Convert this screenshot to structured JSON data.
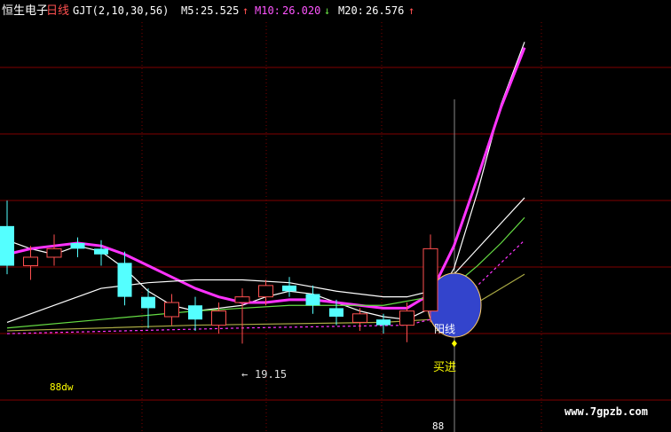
{
  "header": {
    "stock_name": "恒生电子",
    "period": "日线",
    "indicator": "GJT(2,10,30,56)",
    "ma5_label": "M5:",
    "ma5_value": "25.525",
    "ma5_arrow": "↑",
    "ma10_label": "M10:",
    "ma10_value": "26.020",
    "ma10_arrow": "↓",
    "ma20_label": "M20:",
    "ma20_value": "26.576",
    "ma20_arrow": "↑"
  },
  "annotations": {
    "low_price": "19.15",
    "low_arrow": "←",
    "buy_label": "买进",
    "signal_label": "阳线",
    "bottom_left": "88dw",
    "bottom_mid": "88",
    "watermark": "www.7gpzb.com"
  },
  "colors": {
    "background": "#000000",
    "grid": "#800000",
    "up_candle": "#ff5050",
    "down_candle": "#54ffff",
    "ma5": "#ffffff",
    "ma_main": "#ff33ff",
    "ma_green": "#66dd44",
    "ma_olive": "#aaaa44",
    "header_yellow": "#ffff00",
    "header_magenta": "#ff55ff",
    "highlight_circle": "#3344cc",
    "buy_text": "#ffff00"
  },
  "chart_data": {
    "type": "candlestick",
    "title": "恒生电子 日线",
    "price_range": [
      17.5,
      30.5
    ],
    "candles": [
      {
        "dir": "down",
        "open": 23.3,
        "close": 21.9,
        "high": 24.2,
        "low": 21.6
      },
      {
        "dir": "up",
        "open": 21.9,
        "close": 22.2,
        "high": 22.6,
        "low": 21.4
      },
      {
        "dir": "up",
        "open": 22.2,
        "close": 22.5,
        "high": 23.0,
        "low": 21.9
      },
      {
        "dir": "down",
        "open": 22.7,
        "close": 22.5,
        "high": 22.9,
        "low": 22.2
      },
      {
        "dir": "down",
        "open": 22.5,
        "close": 22.3,
        "high": 22.8,
        "low": 21.9
      },
      {
        "dir": "down",
        "open": 22.0,
        "close": 20.8,
        "high": 22.4,
        "low": 20.5
      },
      {
        "dir": "down",
        "open": 20.8,
        "close": 20.4,
        "high": 21.1,
        "low": 19.7
      },
      {
        "dir": "up",
        "open": 20.1,
        "close": 20.6,
        "high": 20.9,
        "low": 19.8
      },
      {
        "dir": "down",
        "open": 20.5,
        "close": 20.0,
        "high": 20.8,
        "low": 19.6
      },
      {
        "dir": "up",
        "open": 19.8,
        "close": 20.3,
        "high": 20.6,
        "low": 19.5
      },
      {
        "dir": "up",
        "open": 20.6,
        "close": 20.8,
        "high": 21.1,
        "low": 19.15
      },
      {
        "dir": "up",
        "open": 20.8,
        "close": 21.2,
        "high": 21.4,
        "low": 20.5
      },
      {
        "dir": "down",
        "open": 21.2,
        "close": 21.0,
        "high": 21.5,
        "low": 20.8
      },
      {
        "dir": "down",
        "open": 20.9,
        "close": 20.5,
        "high": 21.2,
        "low": 20.2
      },
      {
        "dir": "down",
        "open": 20.4,
        "close": 20.1,
        "high": 20.7,
        "low": 19.8
      },
      {
        "dir": "up",
        "open": 19.9,
        "close": 20.2,
        "high": 20.4,
        "low": 19.6
      },
      {
        "dir": "down",
        "open": 20.0,
        "close": 19.8,
        "high": 20.2,
        "low": 19.5
      },
      {
        "dir": "up",
        "open": 19.8,
        "close": 20.3,
        "high": 20.6,
        "low": 19.2
      },
      {
        "dir": "up",
        "open": 20.3,
        "close": 22.5,
        "high": 23.0,
        "low": 19.9
      }
    ],
    "ma_lines": [
      {
        "name": "M5",
        "color": "#ffffff",
        "points": [
          [
            0,
            22.8
          ],
          [
            1,
            22.5
          ],
          [
            2,
            22.3
          ],
          [
            3,
            22.6
          ],
          [
            4,
            22.4
          ],
          [
            5,
            21.8
          ],
          [
            6,
            21.0
          ],
          [
            7,
            20.5
          ],
          [
            8,
            20.3
          ],
          [
            9,
            20.4
          ],
          [
            10,
            20.5
          ],
          [
            11,
            20.8
          ],
          [
            12,
            21.0
          ],
          [
            13,
            20.9
          ],
          [
            14,
            20.6
          ],
          [
            15,
            20.3
          ],
          [
            16,
            20.1
          ],
          [
            17,
            20.0
          ],
          [
            18,
            20.4
          ],
          [
            19,
            21.8
          ],
          [
            20,
            24.5
          ],
          [
            21,
            27.6
          ],
          [
            22,
            29.8
          ]
        ]
      },
      {
        "name": "M10",
        "color": "#ff33ff",
        "points": [
          [
            0,
            22.3
          ],
          [
            1,
            22.5
          ],
          [
            2,
            22.6
          ],
          [
            3,
            22.7
          ],
          [
            4,
            22.6
          ],
          [
            5,
            22.3
          ],
          [
            6,
            21.9
          ],
          [
            7,
            21.5
          ],
          [
            8,
            21.1
          ],
          [
            9,
            20.8
          ],
          [
            10,
            20.6
          ],
          [
            11,
            20.6
          ],
          [
            12,
            20.7
          ],
          [
            13,
            20.7
          ],
          [
            14,
            20.6
          ],
          [
            15,
            20.5
          ],
          [
            16,
            20.4
          ],
          [
            17,
            20.4
          ],
          [
            18,
            20.9
          ],
          [
            19,
            22.6
          ],
          [
            20,
            25.0
          ],
          [
            21,
            27.5
          ],
          [
            22,
            29.6
          ]
        ]
      },
      {
        "name": "M20",
        "color": "#ffffff",
        "points": [
          [
            0,
            19.9
          ],
          [
            2,
            20.5
          ],
          [
            4,
            21.1
          ],
          [
            6,
            21.3
          ],
          [
            8,
            21.4
          ],
          [
            10,
            21.4
          ],
          [
            12,
            21.3
          ],
          [
            14,
            21.0
          ],
          [
            16,
            20.8
          ],
          [
            17,
            20.8
          ],
          [
            18,
            21.0
          ],
          [
            19,
            21.6
          ],
          [
            20,
            22.5
          ],
          [
            21,
            23.4
          ],
          [
            22,
            24.3
          ]
        ]
      },
      {
        "name": "M30",
        "color": "#66dd44",
        "points": [
          [
            0,
            19.7
          ],
          [
            4,
            20.0
          ],
          [
            8,
            20.3
          ],
          [
            12,
            20.5
          ],
          [
            16,
            20.5
          ],
          [
            18,
            20.8
          ],
          [
            19,
            21.2
          ],
          [
            20,
            21.9
          ],
          [
            21,
            22.7
          ],
          [
            22,
            23.6
          ]
        ]
      },
      {
        "name": "M60",
        "color": "#aaaa44",
        "points": [
          [
            0,
            19.6
          ],
          [
            8,
            19.8
          ],
          [
            16,
            19.9
          ],
          [
            18,
            20.0
          ],
          [
            19,
            20.2
          ],
          [
            20,
            20.6
          ],
          [
            21,
            21.1
          ],
          [
            22,
            21.6
          ]
        ]
      },
      {
        "name": "M56",
        "color": "#ff33ff",
        "points": [
          [
            0,
            19.5
          ],
          [
            10,
            19.7
          ],
          [
            17,
            19.8
          ],
          [
            18,
            20.0
          ],
          [
            19,
            20.4
          ],
          [
            20,
            21.2
          ],
          [
            21,
            22.0
          ],
          [
            22,
            22.8
          ]
        ]
      }
    ]
  }
}
